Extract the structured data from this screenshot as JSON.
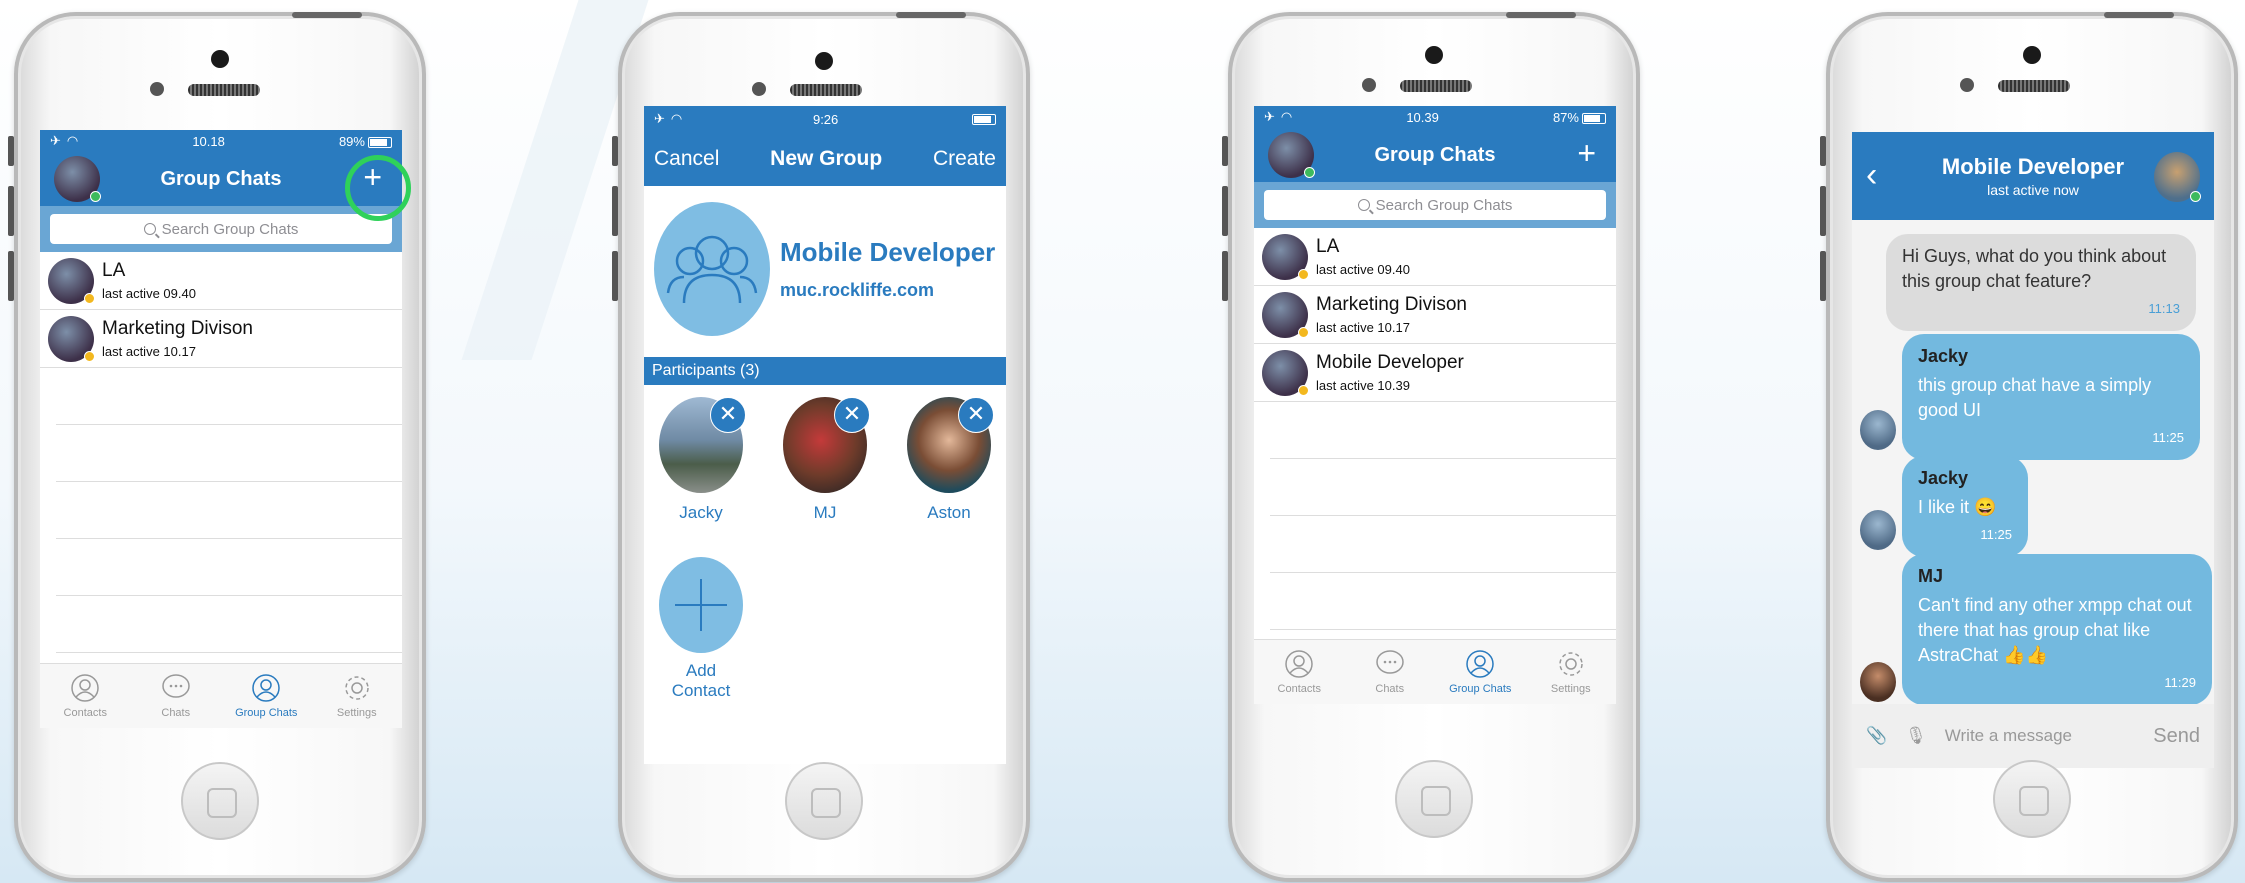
{
  "phone1": {
    "status": {
      "time": "10.18",
      "battery": "89%"
    },
    "nav": {
      "title": "Group Chats",
      "add_icon": "plus-icon"
    },
    "search": {
      "placeholder": "Search Group Chats"
    },
    "chats": [
      {
        "name": "LA",
        "sub": "last active 09.40"
      },
      {
        "name": "Marketing Divison",
        "sub": "last active 10.17"
      }
    ],
    "tabs": [
      {
        "label": "Contacts",
        "icon": "contacts-icon"
      },
      {
        "label": "Chats",
        "icon": "chats-icon"
      },
      {
        "label": "Group Chats",
        "icon": "group-chats-icon"
      },
      {
        "label": "Settings",
        "icon": "settings-icon"
      }
    ],
    "active_tab": "Group Chats",
    "highlight_color": "#2fd15a"
  },
  "phone2": {
    "status": {
      "time": "9:26"
    },
    "nav": {
      "cancel": "Cancel",
      "title": "New Group",
      "create": "Create"
    },
    "group": {
      "name": "Mobile Developer",
      "address": "muc.rockliffe.com"
    },
    "participants_header": "Participants (3)",
    "participants": [
      {
        "name": "Jacky"
      },
      {
        "name": "MJ"
      },
      {
        "name": "Aston"
      }
    ],
    "add_contact": "Add Contact"
  },
  "phone3": {
    "status": {
      "time": "10.39",
      "battery": "87%"
    },
    "nav": {
      "title": "Group Chats"
    },
    "search": {
      "placeholder": "Search Group Chats"
    },
    "chats": [
      {
        "name": "LA",
        "sub": "last active 09.40"
      },
      {
        "name": "Marketing Divison",
        "sub": "last active 10.17"
      },
      {
        "name": "Mobile Developer",
        "sub": "last active 10.39"
      }
    ],
    "tabs": [
      {
        "label": "Contacts"
      },
      {
        "label": "Chats"
      },
      {
        "label": "Group Chats"
      },
      {
        "label": "Settings"
      }
    ]
  },
  "phone4": {
    "nav": {
      "title": "Mobile Developer",
      "sub": "last active now"
    },
    "messages": [
      {
        "sender": "",
        "text": "Hi Guys, what do you think about this group chat feature?",
        "time": "11:13"
      },
      {
        "sender": "Jacky",
        "text": "this group chat have a simply good UI",
        "time": "11:25"
      },
      {
        "sender": "Jacky",
        "text": "I like it 😄",
        "time": "11:25"
      },
      {
        "sender": "MJ",
        "text": "Can't find any other xmpp chat out there that has group chat like AstraChat 👍👍",
        "time": "11:29"
      }
    ],
    "input": {
      "placeholder": "Write a message",
      "send": "Send"
    }
  },
  "colors": {
    "brand": "#2a7bbf",
    "light_blue": "#73b9df",
    "online": "#3dba5d",
    "away": "#f3b81f"
  }
}
